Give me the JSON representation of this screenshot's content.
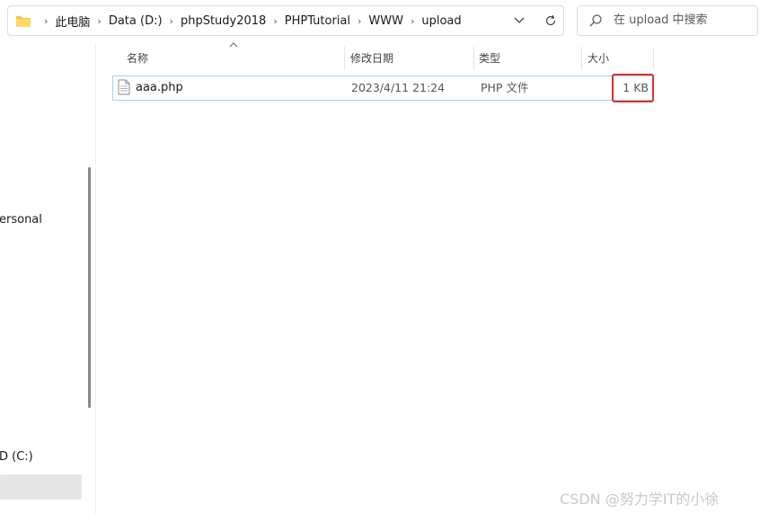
{
  "address_bar": {
    "breadcrumbs": [
      "此电脑",
      "Data (D:)",
      "phpStudy2018",
      "PHPTutorial",
      "WWW",
      "upload"
    ]
  },
  "search": {
    "placeholder": "在 upload 中搜索"
  },
  "nav": {
    "items": [
      {
        "label": "ersonal"
      },
      {
        "label": "D (C:)"
      }
    ]
  },
  "columns": {
    "name": "名称",
    "date": "修改日期",
    "type": "类型",
    "size": "大小"
  },
  "files": [
    {
      "name": "aaa.php",
      "date": "2023/4/11 21:24",
      "type": "PHP 文件",
      "size": "1 KB"
    }
  ],
  "watermark": "CSDN @努力学IT的小徐",
  "colors": {
    "selection_border": "#99d9ea",
    "highlight_box": "#e52b2b",
    "folder_yellow": "#f5c542"
  },
  "icons": {
    "folder": "folder-icon",
    "dropdown": "chevron-down-icon",
    "refresh": "refresh-icon",
    "search": "search-icon",
    "file": "php-file-icon",
    "sort": "sort-ascending-icon"
  }
}
